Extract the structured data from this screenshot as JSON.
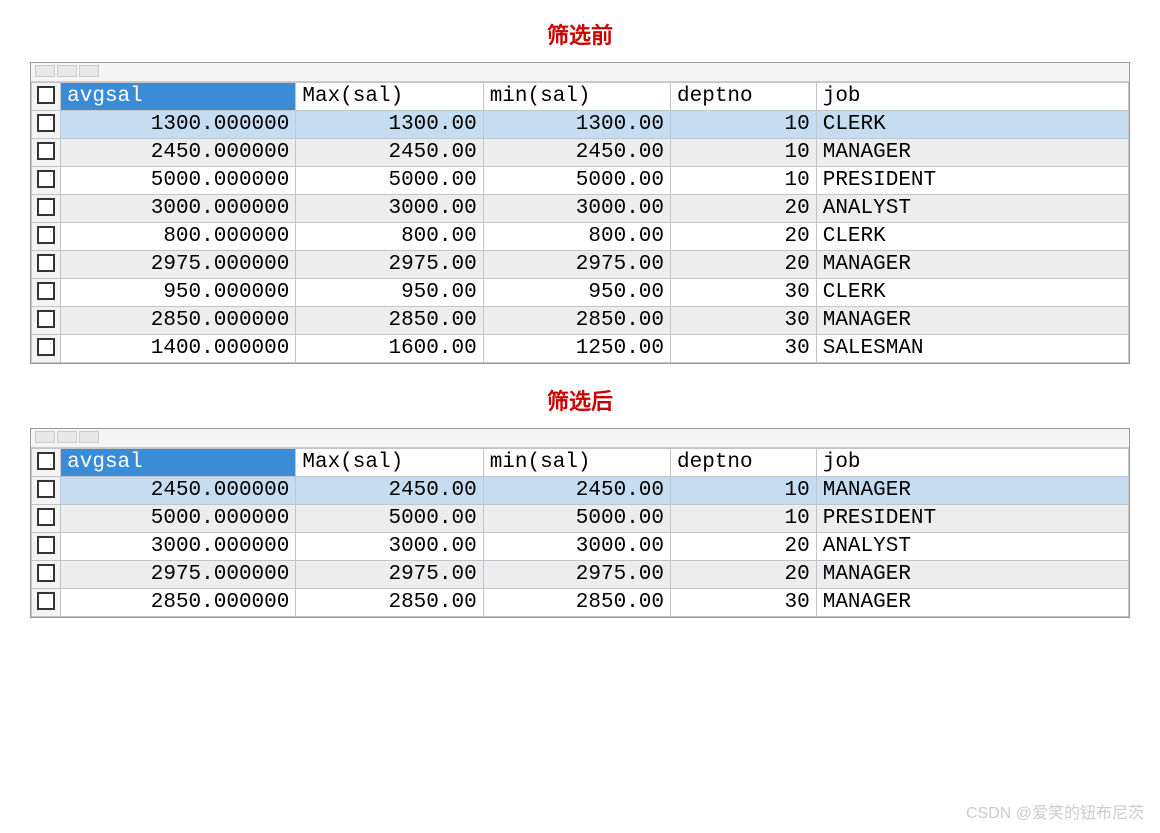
{
  "before": {
    "title": "筛选前",
    "columns": [
      "avgsal",
      "Max(sal)",
      "min(sal)",
      "deptno",
      "job"
    ],
    "rows": [
      {
        "avgsal": "1300.000000",
        "max": "1300.00",
        "min": "1300.00",
        "deptno": "10",
        "job": "CLERK",
        "selected": true
      },
      {
        "avgsal": "2450.000000",
        "max": "2450.00",
        "min": "2450.00",
        "deptno": "10",
        "job": "MANAGER",
        "selected": false
      },
      {
        "avgsal": "5000.000000",
        "max": "5000.00",
        "min": "5000.00",
        "deptno": "10",
        "job": "PRESIDENT",
        "selected": false
      },
      {
        "avgsal": "3000.000000",
        "max": "3000.00",
        "min": "3000.00",
        "deptno": "20",
        "job": "ANALYST",
        "selected": false
      },
      {
        "avgsal": "800.000000",
        "max": "800.00",
        "min": "800.00",
        "deptno": "20",
        "job": "CLERK",
        "selected": false
      },
      {
        "avgsal": "2975.000000",
        "max": "2975.00",
        "min": "2975.00",
        "deptno": "20",
        "job": "MANAGER",
        "selected": false
      },
      {
        "avgsal": "950.000000",
        "max": "950.00",
        "min": "950.00",
        "deptno": "30",
        "job": "CLERK",
        "selected": false
      },
      {
        "avgsal": "2850.000000",
        "max": "2850.00",
        "min": "2850.00",
        "deptno": "30",
        "job": "MANAGER",
        "selected": false
      },
      {
        "avgsal": "1400.000000",
        "max": "1600.00",
        "min": "1250.00",
        "deptno": "30",
        "job": "SALESMAN",
        "selected": false
      }
    ]
  },
  "after": {
    "title": "筛选后",
    "columns": [
      "avgsal",
      "Max(sal)",
      "min(sal)",
      "deptno",
      "job"
    ],
    "rows": [
      {
        "avgsal": "2450.000000",
        "max": "2450.00",
        "min": "2450.00",
        "deptno": "10",
        "job": "MANAGER",
        "selected": true
      },
      {
        "avgsal": "5000.000000",
        "max": "5000.00",
        "min": "5000.00",
        "deptno": "10",
        "job": "PRESIDENT",
        "selected": false
      },
      {
        "avgsal": "3000.000000",
        "max": "3000.00",
        "min": "3000.00",
        "deptno": "20",
        "job": "ANALYST",
        "selected": false
      },
      {
        "avgsal": "2975.000000",
        "max": "2975.00",
        "min": "2975.00",
        "deptno": "20",
        "job": "MANAGER",
        "selected": false
      },
      {
        "avgsal": "2850.000000",
        "max": "2850.00",
        "min": "2850.00",
        "deptno": "30",
        "job": "MANAGER",
        "selected": false
      }
    ]
  },
  "watermark": "CSDN @爱笑的钮布尼茨"
}
